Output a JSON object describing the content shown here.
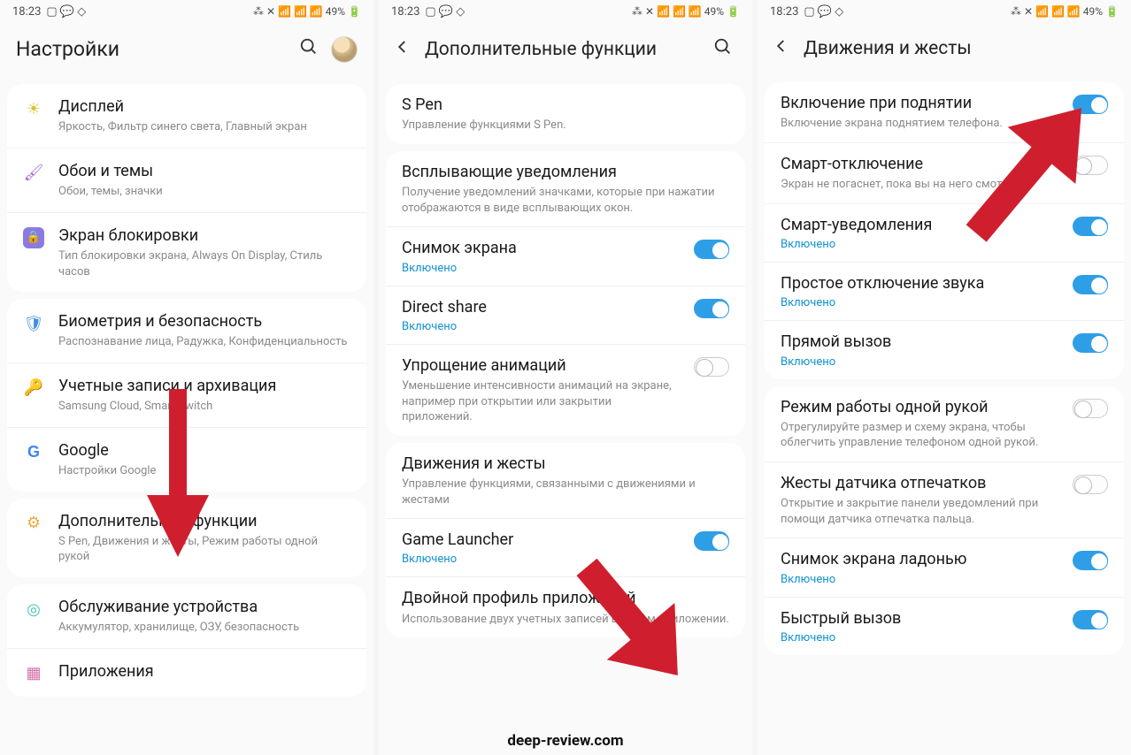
{
  "status": {
    "time": "18:23",
    "left_icons": "▢ 💬 ◇",
    "right": "⁂ ✕ 📶 📶 📶 49% 🔋"
  },
  "watermark": "deep-review.com",
  "screen1": {
    "title": "Настройки",
    "items": [
      {
        "icon": "☀️",
        "color": "#d7c430",
        "title": "Дисплей",
        "sub": "Яркость, Фильтр синего света, Главный экран"
      },
      {
        "icon": "🖌",
        "color": "#a56bd6",
        "title": "Обои и темы",
        "sub": "Обои, темы, значки"
      },
      {
        "icon": "🔒",
        "color": "#8b7be0",
        "title": "Экран блокировки",
        "sub": "Тип блокировки экрана, Always On Display, Стиль часов"
      },
      {
        "icon": "🛡",
        "color": "#3d8fe0",
        "title": "Биометрия и безопасность",
        "sub": "Распознавание лица, Радужка, Конфиденциальность"
      },
      {
        "icon": "🔑",
        "color": "#e2a142",
        "title": "Учетные записи и архивация",
        "sub": "Samsung Cloud, Smart Switch"
      },
      {
        "icon": "G",
        "color": "#4285f4",
        "title": "Google",
        "sub": "Настройки Google"
      },
      {
        "icon": "⚙",
        "color": "#eda93f",
        "title": "Дополнительные функции",
        "sub": "S Pen, Движения и жесты, Режим работы одной рукой"
      },
      {
        "icon": "◎",
        "color": "#47c2b0",
        "title": "Обслуживание устройства",
        "sub": "Аккумулятор, хранилище, ОЗУ, безопасность"
      },
      {
        "icon": "▦",
        "color": "#d66fa8",
        "title": "Приложения",
        "sub": ""
      }
    ]
  },
  "screen2": {
    "title": "Дополнительные функции",
    "groups": [
      [
        {
          "title": "S Pen",
          "sub": "Управление функциями S Pen."
        }
      ],
      [
        {
          "title": "Всплывающие уведомления",
          "sub": "Получение уведомлений значками, которые при нажатии отображаются в виде всплывающих окон."
        },
        {
          "title": "Снимок экрана",
          "status": "Включено",
          "toggle": "on"
        },
        {
          "title": "Direct share",
          "status": "Включено",
          "toggle": "on"
        },
        {
          "title": "Упрощение анимаций",
          "sub": "Уменьшение интенсивности анимаций на экране, например при открытии или закрытии приложений.",
          "toggle": "off"
        }
      ],
      [
        {
          "title": "Движения и жесты",
          "sub": "Управление функциями, связанными с движениями и жестами"
        },
        {
          "title": "Game Launcher",
          "status": "Включено",
          "toggle": "on"
        },
        {
          "title": "Двойной профиль приложений",
          "sub": "Использование двух учетных записей в одном приложении."
        }
      ]
    ]
  },
  "screen3": {
    "title": "Движения и жесты",
    "groups": [
      [
        {
          "title": "Включение при поднятии",
          "sub": "Включение экрана поднятием телефона.",
          "toggle": "on"
        },
        {
          "title": "Смарт-отключение",
          "sub": "Экран не погаснет, пока вы на него смотрите.",
          "toggle": "off"
        },
        {
          "title": "Смарт-уведомления",
          "status": "Включено",
          "toggle": "on"
        },
        {
          "title": "Простое отключение звука",
          "status": "Включено",
          "toggle": "on"
        },
        {
          "title": "Прямой вызов",
          "status": "Включено",
          "toggle": "on"
        }
      ],
      [
        {
          "title": "Режим работы одной рукой",
          "sub": "Отрегулируйте размер и схему экрана, чтобы облегчить управление телефоном одной рукой.",
          "toggle": "off"
        },
        {
          "title": "Жесты датчика отпечатков",
          "sub": "Открытие и закрытие панели уведомлений при помощи датчика отпечатка пальца.",
          "toggle": "off"
        },
        {
          "title": "Снимок экрана ладонью",
          "status": "Включено",
          "toggle": "on"
        },
        {
          "title": "Быстрый вызов",
          "status": "Включено",
          "toggle": "on"
        }
      ]
    ]
  }
}
